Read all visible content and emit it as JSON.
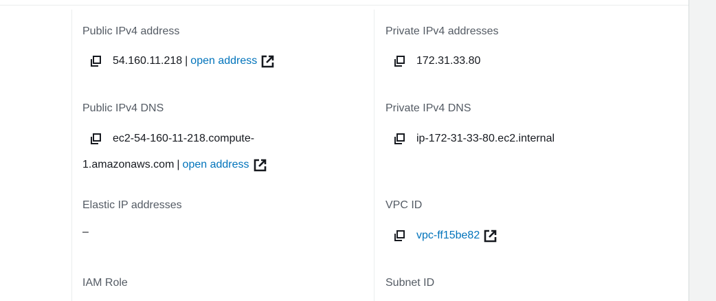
{
  "left_column": {
    "public_ipv4_address": {
      "label": "Public IPv4 address",
      "value": "54.160.11.218",
      "separator": "|",
      "link_label": "open address"
    },
    "public_ipv4_dns": {
      "label": "Public IPv4 DNS",
      "value_line1": "ec2-54-160-11-218.compute-",
      "value_line2": "1.amazonaws.com",
      "separator": "|",
      "link_label": "open address"
    },
    "elastic_ip_addresses": {
      "label": "Elastic IP addresses",
      "value": "–"
    },
    "iam_role": {
      "label": "IAM Role"
    }
  },
  "right_column": {
    "private_ipv4_addresses": {
      "label": "Private IPv4 addresses",
      "value": "172.31.33.80"
    },
    "private_ipv4_dns": {
      "label": "Private IPv4 DNS",
      "value": "ip-172-31-33-80.ec2.internal"
    },
    "vpc_id": {
      "label": "VPC ID",
      "link_label": "vpc-ff15be82"
    },
    "subnet_id": {
      "label": "Subnet ID"
    }
  },
  "icons": {
    "copy": "copy-icon",
    "external_link": "external-link-icon"
  },
  "colors": {
    "link": "#0073bb",
    "label": "#545b64",
    "text": "#16191f"
  }
}
